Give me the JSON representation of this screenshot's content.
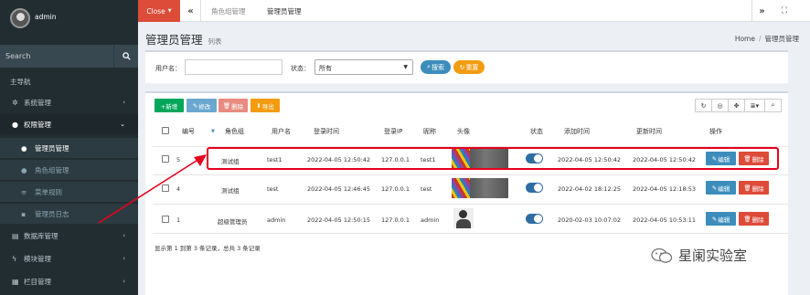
{
  "sidebar": {
    "user_name": "admin",
    "search_placeholder": "Search",
    "header": "主导航",
    "items": [
      {
        "label": "系统管理",
        "icon": "gear-icon"
      },
      {
        "label": "权限管理",
        "icon": "users-icon"
      },
      {
        "label": "数据库管理",
        "icon": "database-icon"
      },
      {
        "label": "模块管理",
        "icon": "bolt-icon"
      },
      {
        "label": "栏目管理",
        "icon": "grid-icon"
      }
    ],
    "sub_items": [
      {
        "label": "管理员管理",
        "icon": "user-icon"
      },
      {
        "label": "角色组管理",
        "icon": "group-icon"
      },
      {
        "label": "菜单规则",
        "icon": "list-icon"
      },
      {
        "label": "管理员日志",
        "icon": "book-icon"
      }
    ]
  },
  "topbar": {
    "close_label": "Close",
    "tabs": [
      "角色组管理",
      "管理员管理"
    ]
  },
  "page": {
    "title": "管理员管理",
    "subtitle": "列表",
    "breadcrumb_home": "Home",
    "breadcrumb_sep": "/",
    "breadcrumb_current": "管理员管理"
  },
  "filter": {
    "username_label": "用户名：",
    "status_label": "状态：",
    "status_value": "所有",
    "search_button": "搜索",
    "reset_button": "重置"
  },
  "toolbar": {
    "add": "+新增",
    "edit": "修改",
    "delete": "删除",
    "export": "导出"
  },
  "table": {
    "headers": [
      "编号",
      "角色组",
      "用户名",
      "登录时间",
      "登录IP",
      "昵称",
      "头像",
      "状态",
      "添加时间",
      "更新时间",
      "操作"
    ],
    "rows": [
      {
        "id": "5",
        "role": "测试组",
        "username": "test1",
        "login_time": "2022-04-05 12:50:42",
        "ip": "127.0.0.1",
        "nickname": "test1",
        "avatar": "landscape",
        "status": true,
        "created": "2022-04-05 12:50:42",
        "updated": "2022-04-05 12:50:42"
      },
      {
        "id": "4",
        "role": "测试组",
        "username": "test",
        "login_time": "2022-04-05 12:46:45",
        "ip": "127.0.0.1",
        "nickname": "test",
        "avatar": "landscape",
        "status": true,
        "created": "2022-04-02 18:12:25",
        "updated": "2022-04-05 12:18:53"
      },
      {
        "id": "1",
        "role": "超级管理员",
        "username": "admin",
        "login_time": "2022-04-05 12:50:15",
        "ip": "127.0.0.1",
        "nickname": "admin",
        "avatar": "person",
        "status": true,
        "created": "2020-02-03 10:07:02",
        "updated": "2022-04-05 10:53:11"
      }
    ],
    "edit_label": "编辑",
    "delete_label": "删除",
    "summary": "显示第 1 到第 3 条记录，总共 3 条记录"
  },
  "watermark": "星阑实验室",
  "colors": {
    "red": "#dd4b39",
    "blue": "#3c8dbc",
    "green": "#00a65a",
    "yellow": "#f39c12",
    "highlight": "#e8001c"
  }
}
